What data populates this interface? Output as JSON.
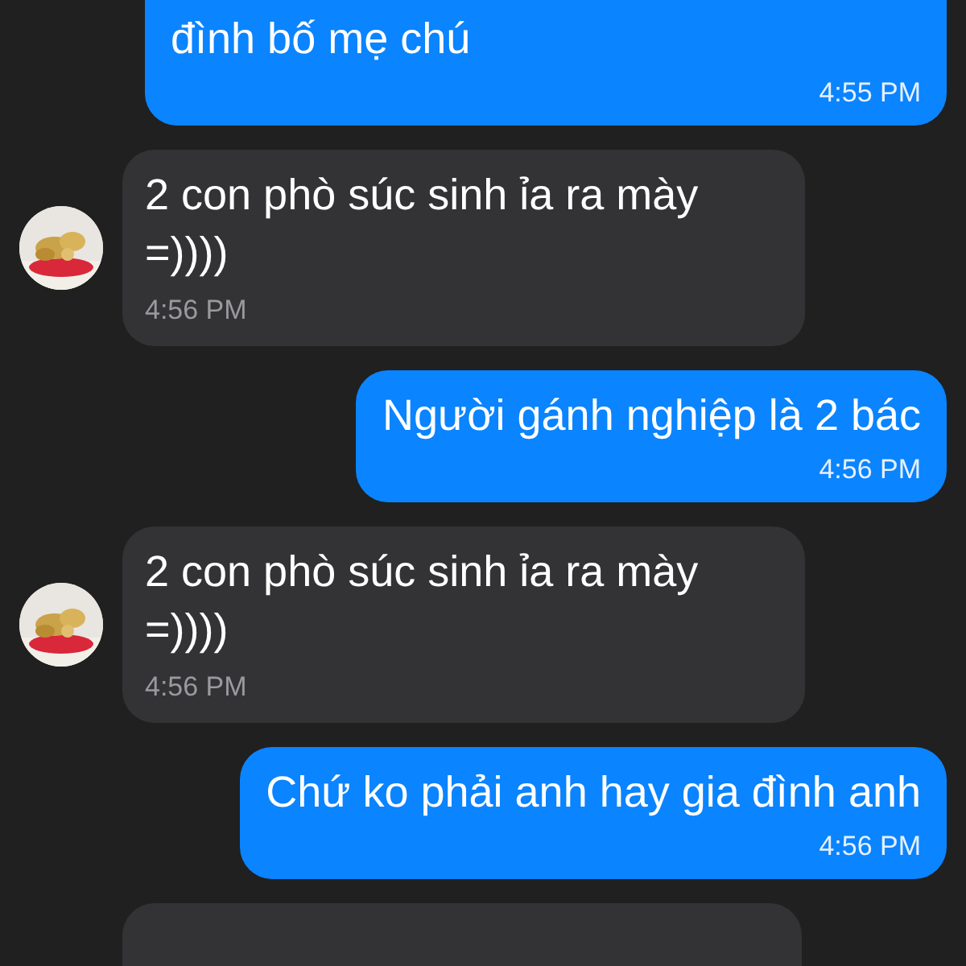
{
  "messages": [
    {
      "kind": "outgoing",
      "text": "đình bố mẹ chú",
      "time": "4:55 PM"
    },
    {
      "kind": "incoming",
      "text": "2 con phò súc sinh ỉa ra mày =))))",
      "time": "4:56 PM"
    },
    {
      "kind": "outgoing",
      "text": "Người gánh nghiệp là 2 bác",
      "time": "4:56 PM"
    },
    {
      "kind": "incoming",
      "text": "2 con phò súc sinh ỉa ra mày =))))",
      "time": "4:56 PM"
    },
    {
      "kind": "outgoing",
      "text": "Chứ ko phải anh hay gia đình anh",
      "time": "4:56 PM"
    },
    {
      "kind": "incoming"
    }
  ]
}
